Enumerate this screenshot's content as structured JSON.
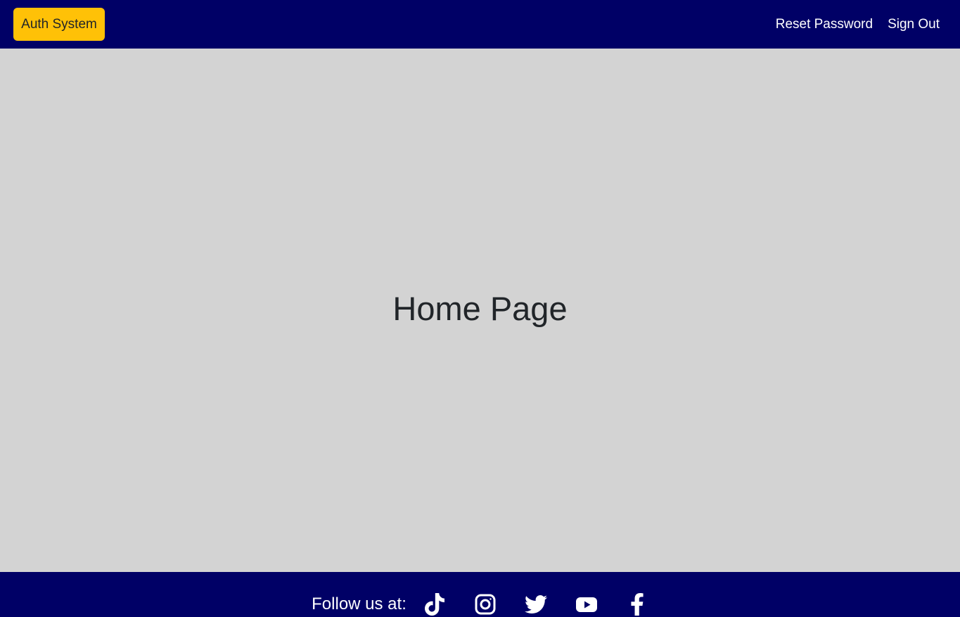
{
  "navbar": {
    "brand_label": "Auth System",
    "links": [
      {
        "label": "Reset Password"
      },
      {
        "label": "Sign Out"
      }
    ]
  },
  "main": {
    "title": "Home Page"
  },
  "footer": {
    "follow_label": "Follow us at:",
    "socials": [
      {
        "icon": "tiktok-icon"
      },
      {
        "icon": "instagram-icon"
      },
      {
        "icon": "twitter-icon"
      },
      {
        "icon": "youtube-icon"
      },
      {
        "icon": "facebook-icon"
      }
    ]
  },
  "colors": {
    "navbar_bg": "#000066",
    "brand_bg": "#ffc107",
    "main_bg": "#d3d3d3",
    "text_dark": "#212529",
    "text_light": "#ffffff"
  }
}
